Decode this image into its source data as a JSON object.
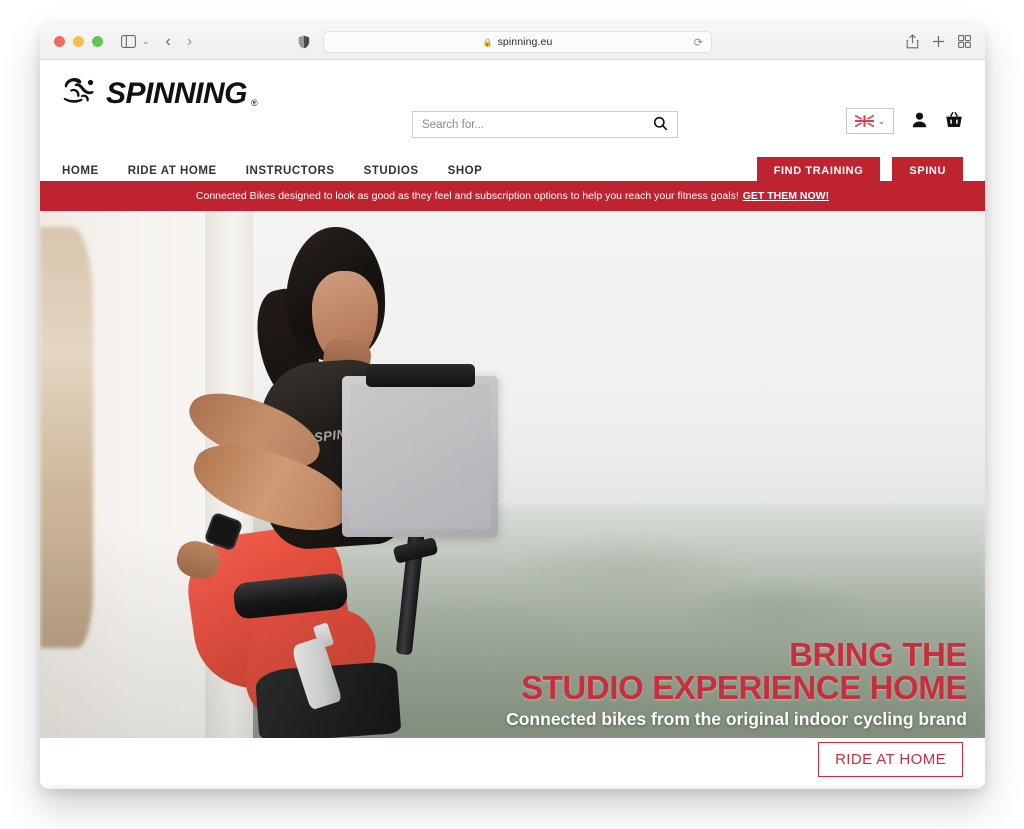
{
  "browser": {
    "traffic_lights": [
      "close",
      "minimize",
      "maximize"
    ],
    "sidebar_icon": "sidebar-icon",
    "sidebar_chevron": "⌄",
    "back_arrow": "‹",
    "forward_arrow": "›",
    "shield_icon": "privacy-shield-icon",
    "url": "spinning.eu",
    "lock_icon": "🔒",
    "reload_icon": "⟳",
    "share_icon": "share-icon",
    "new_tab_icon": "plus-icon",
    "tab_overview_icon": "tab-overview-icon"
  },
  "header": {
    "logo_text": "SPINNING",
    "logo_registered": "®",
    "search": {
      "placeholder": "Search for...",
      "value": "",
      "icon": "search-icon"
    },
    "language": {
      "flag": "uk-flag",
      "chevron": "⌄"
    },
    "account_icon": "user-icon",
    "cart_icon": "basket-icon"
  },
  "nav": {
    "links": [
      {
        "label": "HOME"
      },
      {
        "label": "RIDE AT HOME"
      },
      {
        "label": "INSTRUCTORS"
      },
      {
        "label": "STUDIOS"
      },
      {
        "label": "SHOP"
      }
    ],
    "cta_primary": "FIND TRAINING",
    "cta_secondary": "SPINU"
  },
  "banner": {
    "text": "Connected Bikes designed to look as good as they feel and subscription options to help you reach your fitness goals!",
    "link": "GET THEM NOW!",
    "bg_color": "#bf2330"
  },
  "hero": {
    "headline_line1": "BRING THE",
    "headline_line2": "STUDIO EXPERIENCE HOME",
    "subheadline": "Connected bikes from the original indoor cycling brand",
    "cta": "RIDE AT HOME",
    "headline_color": "#c7303b",
    "bra_text": "SPIN"
  },
  "cards": [
    {
      "name": "card-1"
    },
    {
      "name": "card-2"
    },
    {
      "name": "card-3"
    },
    {
      "name": "card-4"
    },
    {
      "name": "card-5"
    }
  ],
  "colors": {
    "brand_red": "#bd2430",
    "banner_red": "#bf2330",
    "headline_red": "#c7303b"
  }
}
